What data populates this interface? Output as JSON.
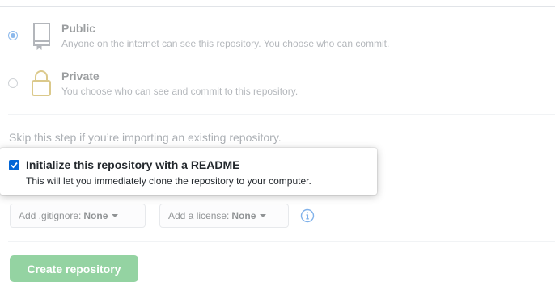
{
  "visibility": {
    "public": {
      "title": "Public",
      "description": "Anyone on the internet can see this repository. You choose who can commit.",
      "selected": true,
      "icon": "repo-icon"
    },
    "private": {
      "title": "Private",
      "description": "You choose who can see and commit to this repository.",
      "selected": false,
      "icon": "lock-icon"
    }
  },
  "skip_note": "Skip this step if you’re importing an existing repository.",
  "readme": {
    "title": "Initialize this repository with a README",
    "description": "This will let you immediately clone the repository to your computer.",
    "checked": true
  },
  "gitignore": {
    "label": "Add .gitignore:",
    "value": "None"
  },
  "license": {
    "label": "Add a license:",
    "value": "None"
  },
  "info_icon": "info-icon",
  "create_button": {
    "label": "Create repository",
    "color": "#94d3a2"
  },
  "colors": {
    "accent": "#0366d6",
    "divider": "#e1e4e8"
  }
}
